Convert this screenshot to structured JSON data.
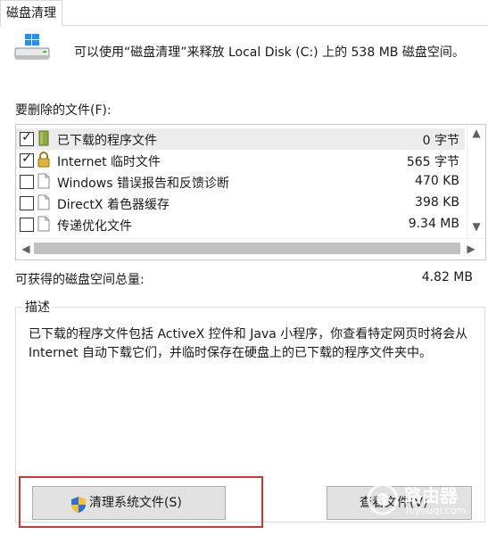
{
  "tab": {
    "label": "磁盘清理"
  },
  "header": {
    "text": "可以使用“磁盘清理”来释放 Local Disk (C:) 上的 538 MB 磁盘空间。",
    "icon": "windows-drive-icon"
  },
  "files_section": {
    "label": "要删除的文件(F):"
  },
  "files": [
    {
      "name": "已下载的程序文件",
      "size": "0 字节",
      "checked": true,
      "icon": "folder-icon",
      "selected": true
    },
    {
      "name": "Internet 临时文件",
      "size": "565 字节",
      "checked": true,
      "icon": "lock-icon",
      "selected": false
    },
    {
      "name": "Windows 错误报告和反馈诊断",
      "size": "470 KB",
      "checked": false,
      "icon": "document-icon",
      "selected": false
    },
    {
      "name": "DirectX 着色器缓存",
      "size": "398 KB",
      "checked": false,
      "icon": "document-icon",
      "selected": false
    },
    {
      "name": "传递优化文件",
      "size": "9.34 MB",
      "checked": false,
      "icon": "document-icon",
      "selected": false
    }
  ],
  "total": {
    "label": "可获得的磁盘空间总量:",
    "value": "4.82 MB"
  },
  "description": {
    "title": "描述",
    "text": "已下载的程序文件包括 ActiveX 控件和 Java 小程序，你查看特定网页时将会从 Internet 自动下载它们，并临时保存在硬盘上的已下载的程序文件夹中。"
  },
  "buttons": {
    "clean_system": "清理系统文件(S)",
    "view_files": "查看文件(V)"
  },
  "watermark": {
    "text": "路由器",
    "subtext": "luyouqi.com"
  },
  "colors": {
    "highlight": "#d9352d",
    "selection": "#ececec",
    "button_bg": "#e1e1e1"
  }
}
